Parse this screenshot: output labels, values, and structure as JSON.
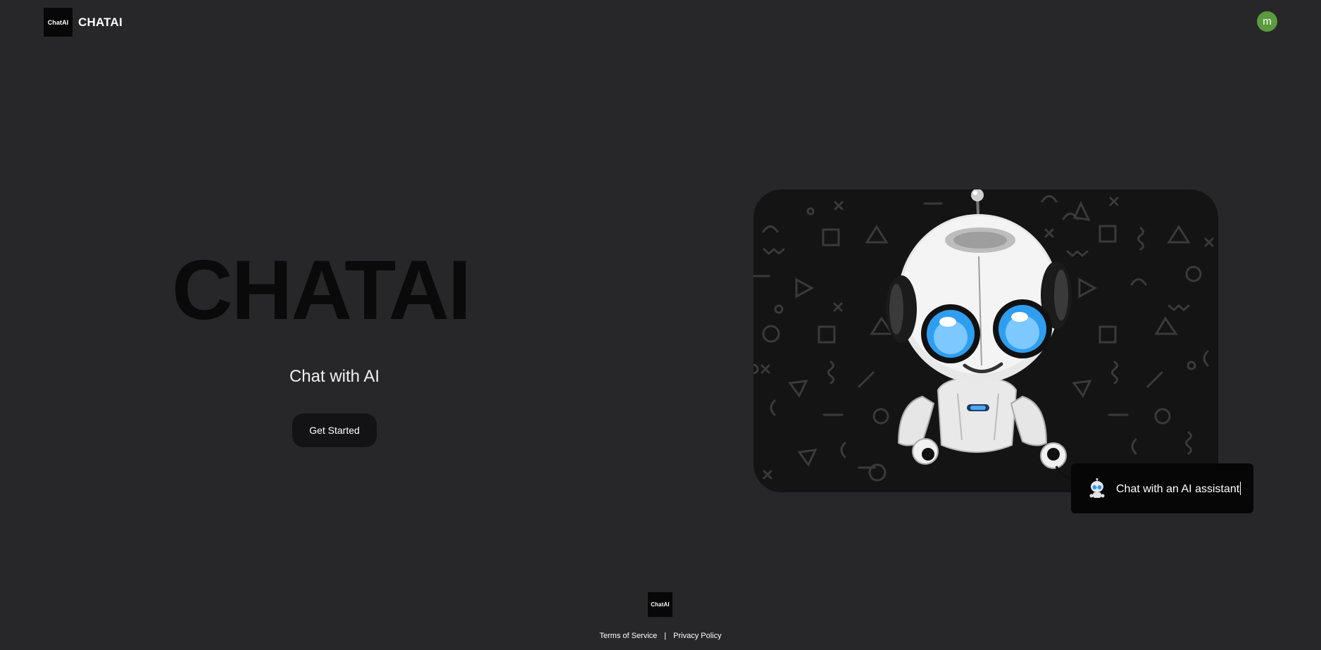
{
  "header": {
    "logo_text": "ChatAI",
    "brand_name": "CHATAI",
    "avatar_initial": "m"
  },
  "hero": {
    "title": "CHATAI",
    "subtitle": "Chat with AI",
    "cta_label": "Get Started"
  },
  "illustration": {
    "bubble_text": "Chat with an AI assistant"
  },
  "footer": {
    "logo_text": "ChatAI",
    "links": [
      "Terms of Service",
      "Privacy Policy"
    ],
    "separator": "|"
  },
  "colors": {
    "background": "#27272a",
    "avatar": "#5b9b3d",
    "button": "#131315",
    "robot_eye": "#2f9ef0"
  },
  "icons": [
    "chatai-logo",
    "robot-illustration",
    "robot-icon"
  ]
}
